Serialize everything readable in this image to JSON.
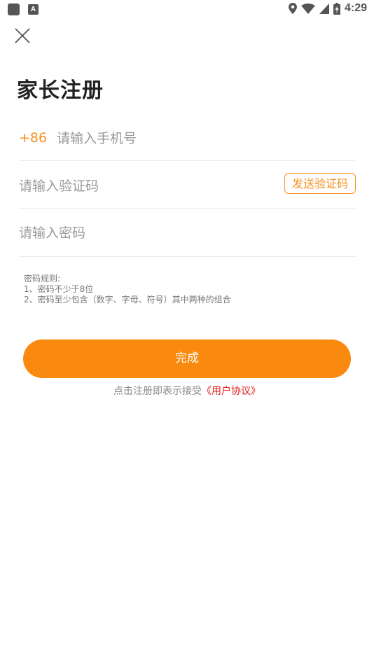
{
  "status_bar": {
    "time": "4:29",
    "notification_icons": [
      "square-icon",
      "text-a-icon"
    ],
    "system_icons": [
      "location-icon",
      "wifi-icon",
      "signal-icon",
      "battery-icon"
    ]
  },
  "header": {
    "close_icon": "close-icon",
    "title": "家长注册"
  },
  "form": {
    "phone": {
      "prefix": "+86",
      "placeholder": "请输入手机号",
      "value": ""
    },
    "code": {
      "placeholder": "请输入验证码",
      "value": "",
      "send_label": "发送验证码"
    },
    "password": {
      "placeholder": "请输入密码",
      "value": ""
    }
  },
  "rules": {
    "heading": "密码规则:",
    "line1": "1、密码不少于8位",
    "line2": "2、密码至少包含（数字、字母、符号）其中两种的组合"
  },
  "submit_label": "完成",
  "agreement": {
    "prefix": "点击注册即表示接受",
    "link": "《用户协议》"
  },
  "colors": {
    "accent": "#f98a0f",
    "link": "#e41b1b",
    "placeholder": "#9a9a9a"
  }
}
